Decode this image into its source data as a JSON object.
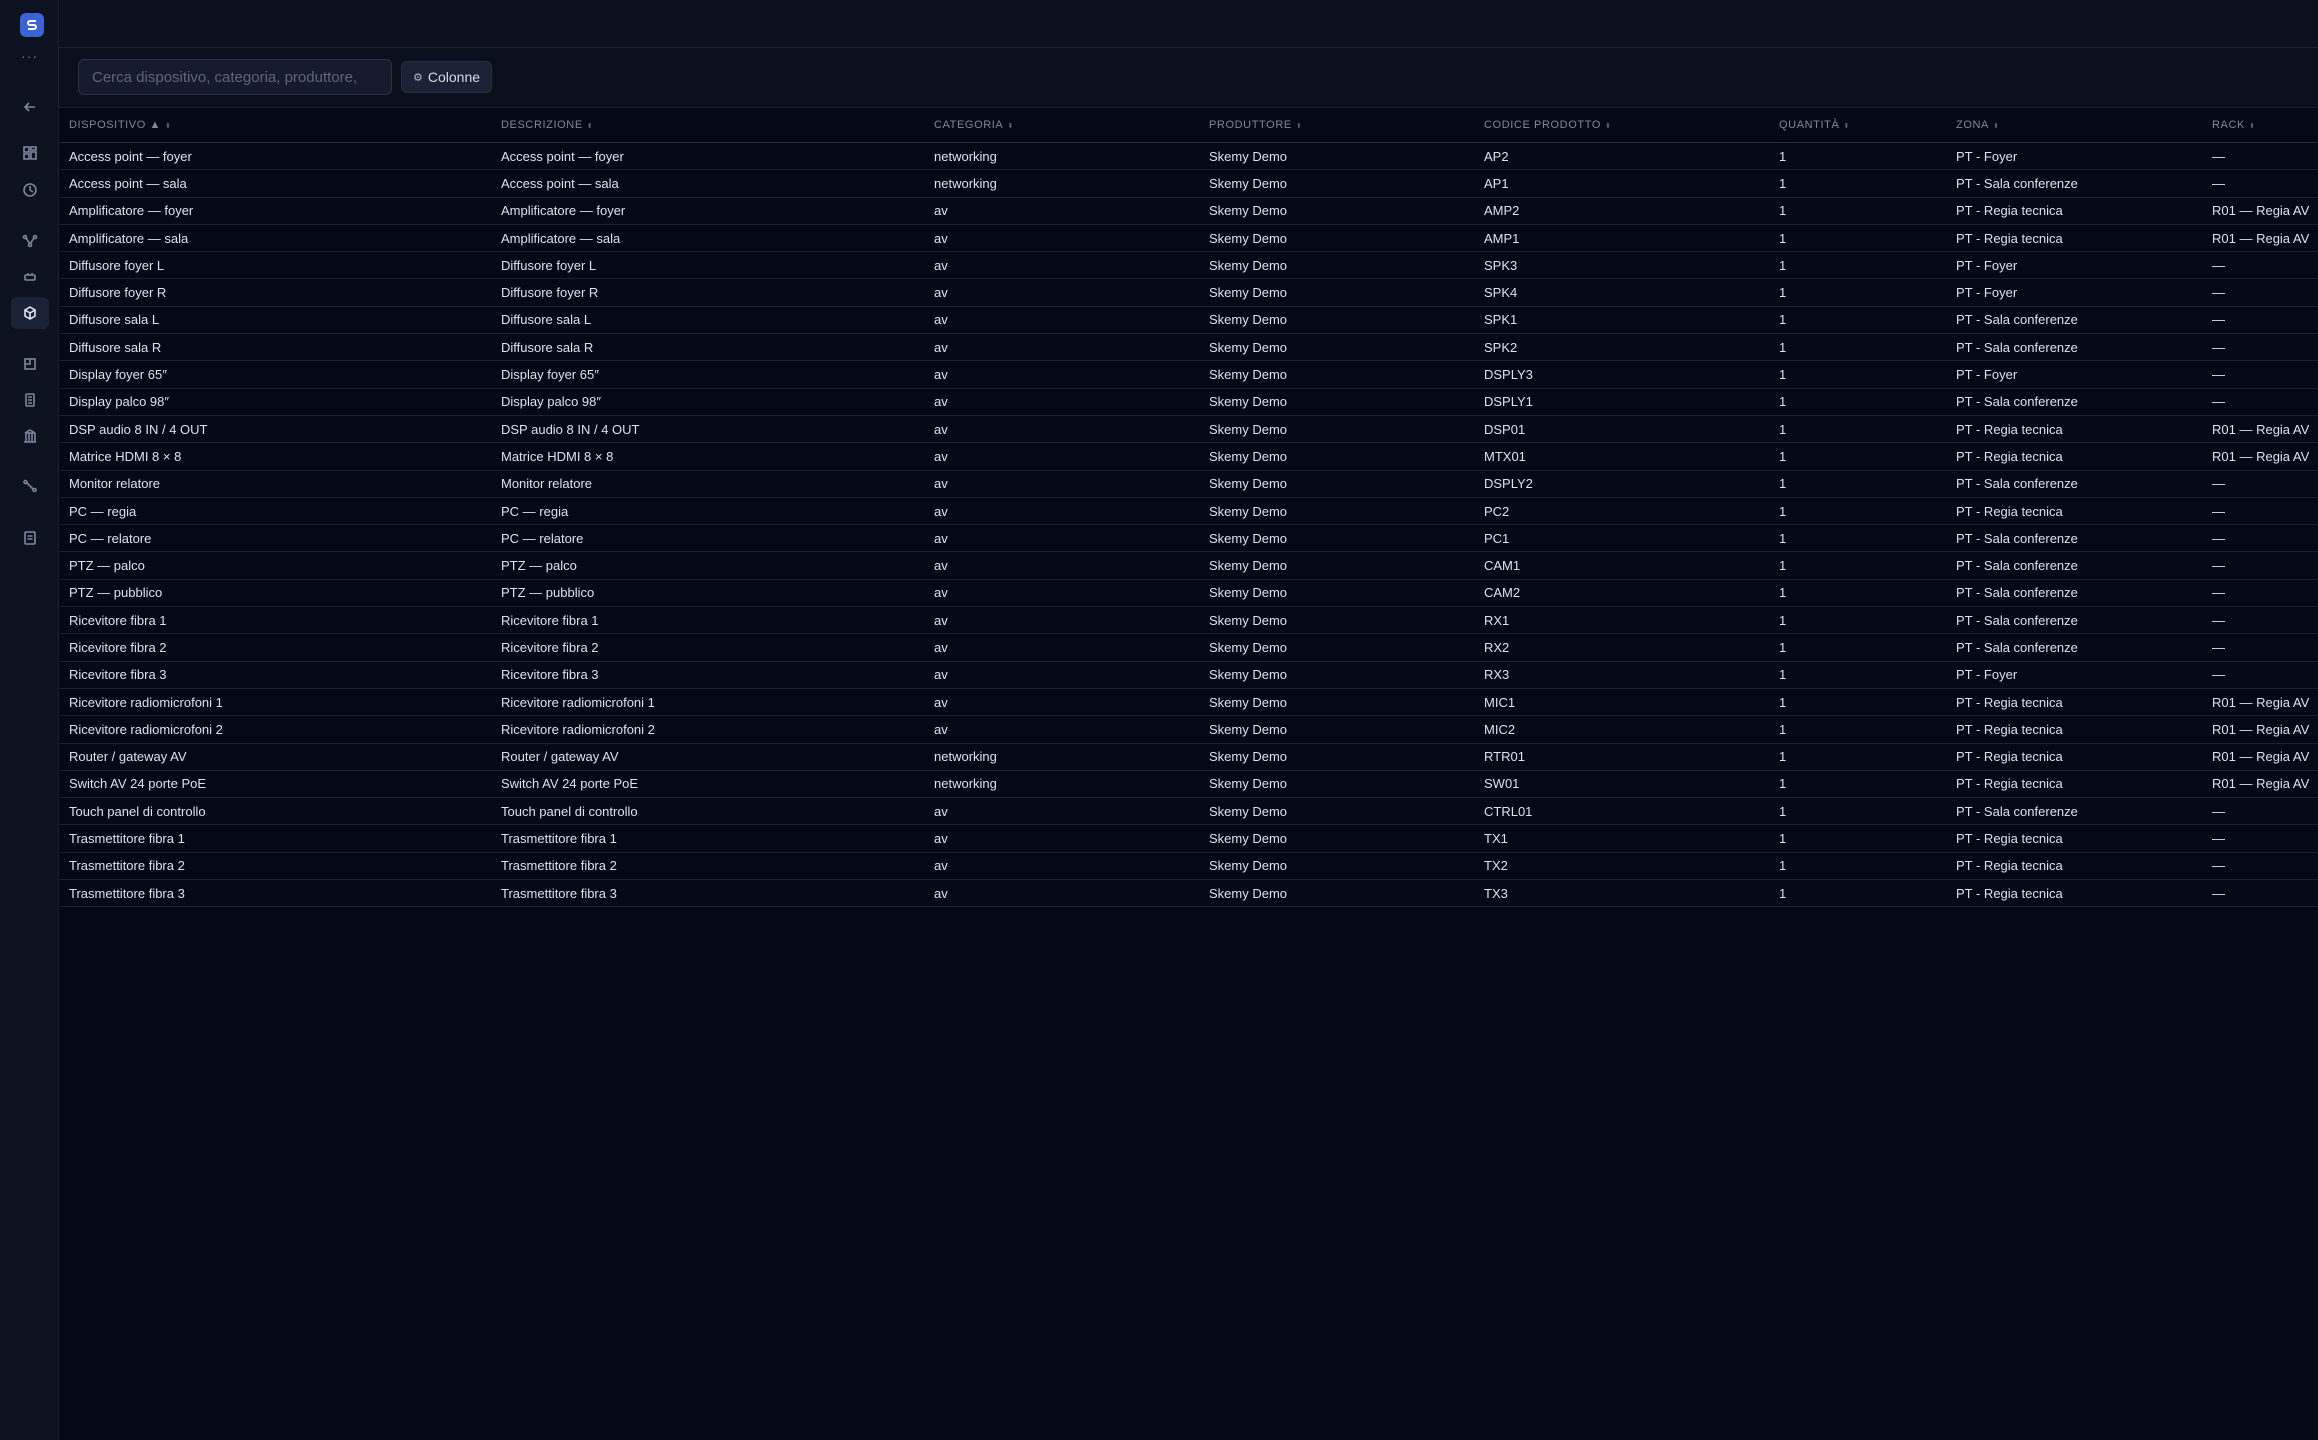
{
  "sidebar": {
    "more": "···",
    "icons": [
      "back-arrow-icon",
      "dashboard-icon",
      "clock-icon",
      "filter-icon",
      "device-icon",
      "cube-icon",
      "layout-icon",
      "document-icon",
      "building-icon",
      "connection-icon",
      "report-icon"
    ]
  },
  "toolbar": {
    "search_placeholder": "Cerca dispositivo, categoria, produttore,",
    "columns_label": "Colonne"
  },
  "table": {
    "headers": [
      "DISPOSITIVO ▲",
      "DESCRIZIONE",
      "CATEGORIA",
      "PRODUTTORE",
      "CODICE PRODOTTO",
      "QUANTITÀ",
      "ZONA",
      "RACK"
    ],
    "rows": [
      [
        "Access point — foyer",
        "Access point — foyer",
        "networking",
        "Skemy Demo",
        "AP2",
        "1",
        "PT - Foyer",
        "—"
      ],
      [
        "Access point — sala",
        "Access point — sala",
        "networking",
        "Skemy Demo",
        "AP1",
        "1",
        "PT - Sala conferenze",
        "—"
      ],
      [
        "Amplificatore — foyer",
        "Amplificatore — foyer",
        "av",
        "Skemy Demo",
        "AMP2",
        "1",
        "PT - Regia tecnica",
        "R01 — Regia AV"
      ],
      [
        "Amplificatore — sala",
        "Amplificatore — sala",
        "av",
        "Skemy Demo",
        "AMP1",
        "1",
        "PT - Regia tecnica",
        "R01 — Regia AV"
      ],
      [
        "Diffusore foyer L",
        "Diffusore foyer L",
        "av",
        "Skemy Demo",
        "SPK3",
        "1",
        "PT - Foyer",
        "—"
      ],
      [
        "Diffusore foyer R",
        "Diffusore foyer R",
        "av",
        "Skemy Demo",
        "SPK4",
        "1",
        "PT - Foyer",
        "—"
      ],
      [
        "Diffusore sala L",
        "Diffusore sala L",
        "av",
        "Skemy Demo",
        "SPK1",
        "1",
        "PT - Sala conferenze",
        "—"
      ],
      [
        "Diffusore sala R",
        "Diffusore sala R",
        "av",
        "Skemy Demo",
        "SPK2",
        "1",
        "PT - Sala conferenze",
        "—"
      ],
      [
        "Display foyer 65″",
        "Display foyer 65″",
        "av",
        "Skemy Demo",
        "DSPLY3",
        "1",
        "PT - Foyer",
        "—"
      ],
      [
        "Display palco 98″",
        "Display palco 98″",
        "av",
        "Skemy Demo",
        "DSPLY1",
        "1",
        "PT - Sala conferenze",
        "—"
      ],
      [
        "DSP audio 8 IN / 4 OUT",
        "DSP audio 8 IN / 4 OUT",
        "av",
        "Skemy Demo",
        "DSP01",
        "1",
        "PT - Regia tecnica",
        "R01 — Regia AV"
      ],
      [
        "Matrice HDMI 8 × 8",
        "Matrice HDMI 8 × 8",
        "av",
        "Skemy Demo",
        "MTX01",
        "1",
        "PT - Regia tecnica",
        "R01 — Regia AV"
      ],
      [
        "Monitor relatore",
        "Monitor relatore",
        "av",
        "Skemy Demo",
        "DSPLY2",
        "1",
        "PT - Sala conferenze",
        "—"
      ],
      [
        "PC — regia",
        "PC — regia",
        "av",
        "Skemy Demo",
        "PC2",
        "1",
        "PT - Regia tecnica",
        "—"
      ],
      [
        "PC — relatore",
        "PC — relatore",
        "av",
        "Skemy Demo",
        "PC1",
        "1",
        "PT - Sala conferenze",
        "—"
      ],
      [
        "PTZ — palco",
        "PTZ — palco",
        "av",
        "Skemy Demo",
        "CAM1",
        "1",
        "PT - Sala conferenze",
        "—"
      ],
      [
        "PTZ — pubblico",
        "PTZ — pubblico",
        "av",
        "Skemy Demo",
        "CAM2",
        "1",
        "PT - Sala conferenze",
        "—"
      ],
      [
        "Ricevitore fibra 1",
        "Ricevitore fibra 1",
        "av",
        "Skemy Demo",
        "RX1",
        "1",
        "PT - Sala conferenze",
        "—"
      ],
      [
        "Ricevitore fibra 2",
        "Ricevitore fibra 2",
        "av",
        "Skemy Demo",
        "RX2",
        "1",
        "PT - Sala conferenze",
        "—"
      ],
      [
        "Ricevitore fibra 3",
        "Ricevitore fibra 3",
        "av",
        "Skemy Demo",
        "RX3",
        "1",
        "PT - Foyer",
        "—"
      ],
      [
        "Ricevitore radiomicrofoni 1",
        "Ricevitore radiomicrofoni 1",
        "av",
        "Skemy Demo",
        "MIC1",
        "1",
        "PT - Regia tecnica",
        "R01 — Regia AV"
      ],
      [
        "Ricevitore radiomicrofoni 2",
        "Ricevitore radiomicrofoni 2",
        "av",
        "Skemy Demo",
        "MIC2",
        "1",
        "PT - Regia tecnica",
        "R01 — Regia AV"
      ],
      [
        "Router / gateway AV",
        "Router / gateway AV",
        "networking",
        "Skemy Demo",
        "RTR01",
        "1",
        "PT - Regia tecnica",
        "R01 — Regia AV"
      ],
      [
        "Switch AV 24 porte PoE",
        "Switch AV 24 porte PoE",
        "networking",
        "Skemy Demo",
        "SW01",
        "1",
        "PT - Regia tecnica",
        "R01 — Regia AV"
      ],
      [
        "Touch panel di controllo",
        "Touch panel di controllo",
        "av",
        "Skemy Demo",
        "CTRL01",
        "1",
        "PT - Sala conferenze",
        "—"
      ],
      [
        "Trasmettitore fibra 1",
        "Trasmettitore fibra 1",
        "av",
        "Skemy Demo",
        "TX1",
        "1",
        "PT - Regia tecnica",
        "—"
      ],
      [
        "Trasmettitore fibra 2",
        "Trasmettitore fibra 2",
        "av",
        "Skemy Demo",
        "TX2",
        "1",
        "PT - Regia tecnica",
        "—"
      ],
      [
        "Trasmettitore fibra 3",
        "Trasmettitore fibra 3",
        "av",
        "Skemy Demo",
        "TX3",
        "1",
        "PT - Regia tecnica",
        "—"
      ]
    ]
  }
}
